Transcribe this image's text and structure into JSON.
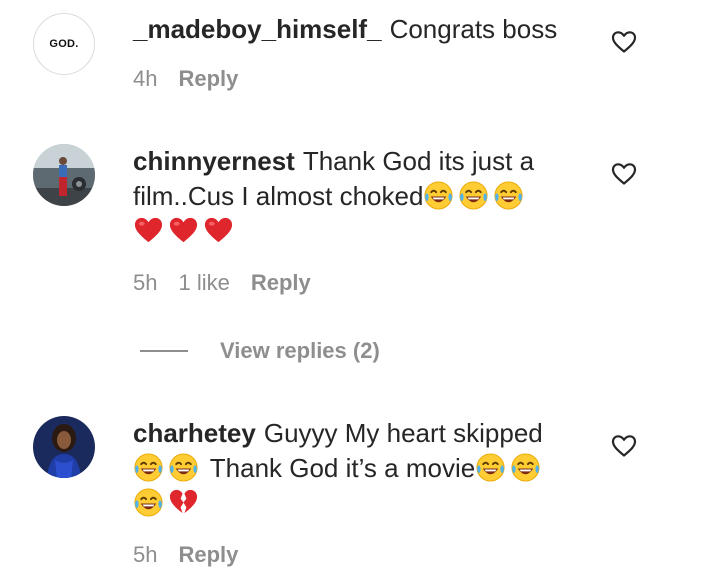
{
  "comments": [
    {
      "username": "_madeboy_himself_",
      "text": "Congrats boss",
      "avatar_text": "GOD.",
      "time": "4h",
      "reply_label": "Reply"
    },
    {
      "username": "chinnyernest",
      "text": "Thank God its just a film..Cus I almost choked",
      "time": "5h",
      "likes": "1 like",
      "reply_label": "Reply"
    },
    {
      "username": "charhetey",
      "text_part1": "Guyyy My heart skipped",
      "text_part2": "Thank God it’s a movie",
      "time": "5h",
      "reply_label": "Reply"
    }
  ],
  "view_replies_label": "View replies (2)",
  "colors": {
    "text": "#262626",
    "muted": "#8e8e8e",
    "heart_red": "#e0262d",
    "emoji_yellow": "#ffcc33"
  },
  "icons": [
    "heart-outline-icon",
    "red-heart-emoji",
    "laughing-tears-emoji",
    "broken-heart-emoji"
  ]
}
